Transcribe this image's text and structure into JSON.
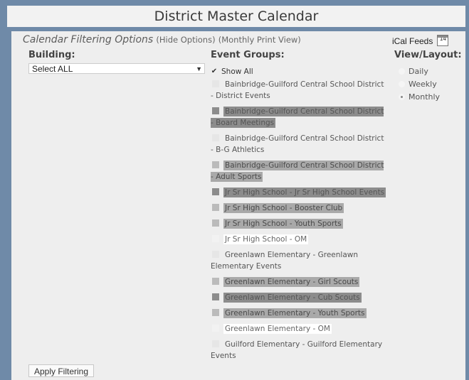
{
  "page": {
    "title": "District Master Calendar"
  },
  "filter_header": {
    "label": "Calendar Filtering Options",
    "hide_options": "(Hide Options)",
    "monthly_print_view": "(Monthly Print View)"
  },
  "ical": {
    "label": "iCal Feeds",
    "icon": "calendar-icon",
    "icon_text": "14"
  },
  "building": {
    "heading": "Building:",
    "selected": "Select ALL"
  },
  "event_groups": {
    "heading": "Event Groups:",
    "show_all": "Show All",
    "items": [
      {
        "label": "Bainbridge-Guilford Central School District - District Events"
      },
      {
        "label": "Bainbridge-Guilford Central School District - Board Meetings"
      },
      {
        "label": "Bainbridge-Guilford Central School District - B-G Athletics"
      },
      {
        "label": "Bainbridge-Guilford Central School District - Adult Sports"
      },
      {
        "label": "Jr Sr High School - Jr Sr High School Events"
      },
      {
        "label": "Jr Sr High School - Booster Club"
      },
      {
        "label": "Jr Sr High School - Youth Sports"
      },
      {
        "label": "Jr Sr High School - OM"
      },
      {
        "label": "Greenlawn Elementary - Greenlawn Elementary Events"
      },
      {
        "label": "Greenlawn Elementary - Girl Scouts"
      },
      {
        "label": "Greenlawn Elementary - Cub Scouts"
      },
      {
        "label": "Greenlawn Elementary - Youth Sports"
      },
      {
        "label": "Greenlawn Elementary - OM"
      },
      {
        "label": "Guilford Elementary - Guilford Elementary Events"
      }
    ]
  },
  "view_layout": {
    "heading": "View/Layout:",
    "options": [
      "Daily",
      "Weekly",
      "Monthly"
    ],
    "selected": "Monthly"
  },
  "apply_button": "Apply Filtering"
}
